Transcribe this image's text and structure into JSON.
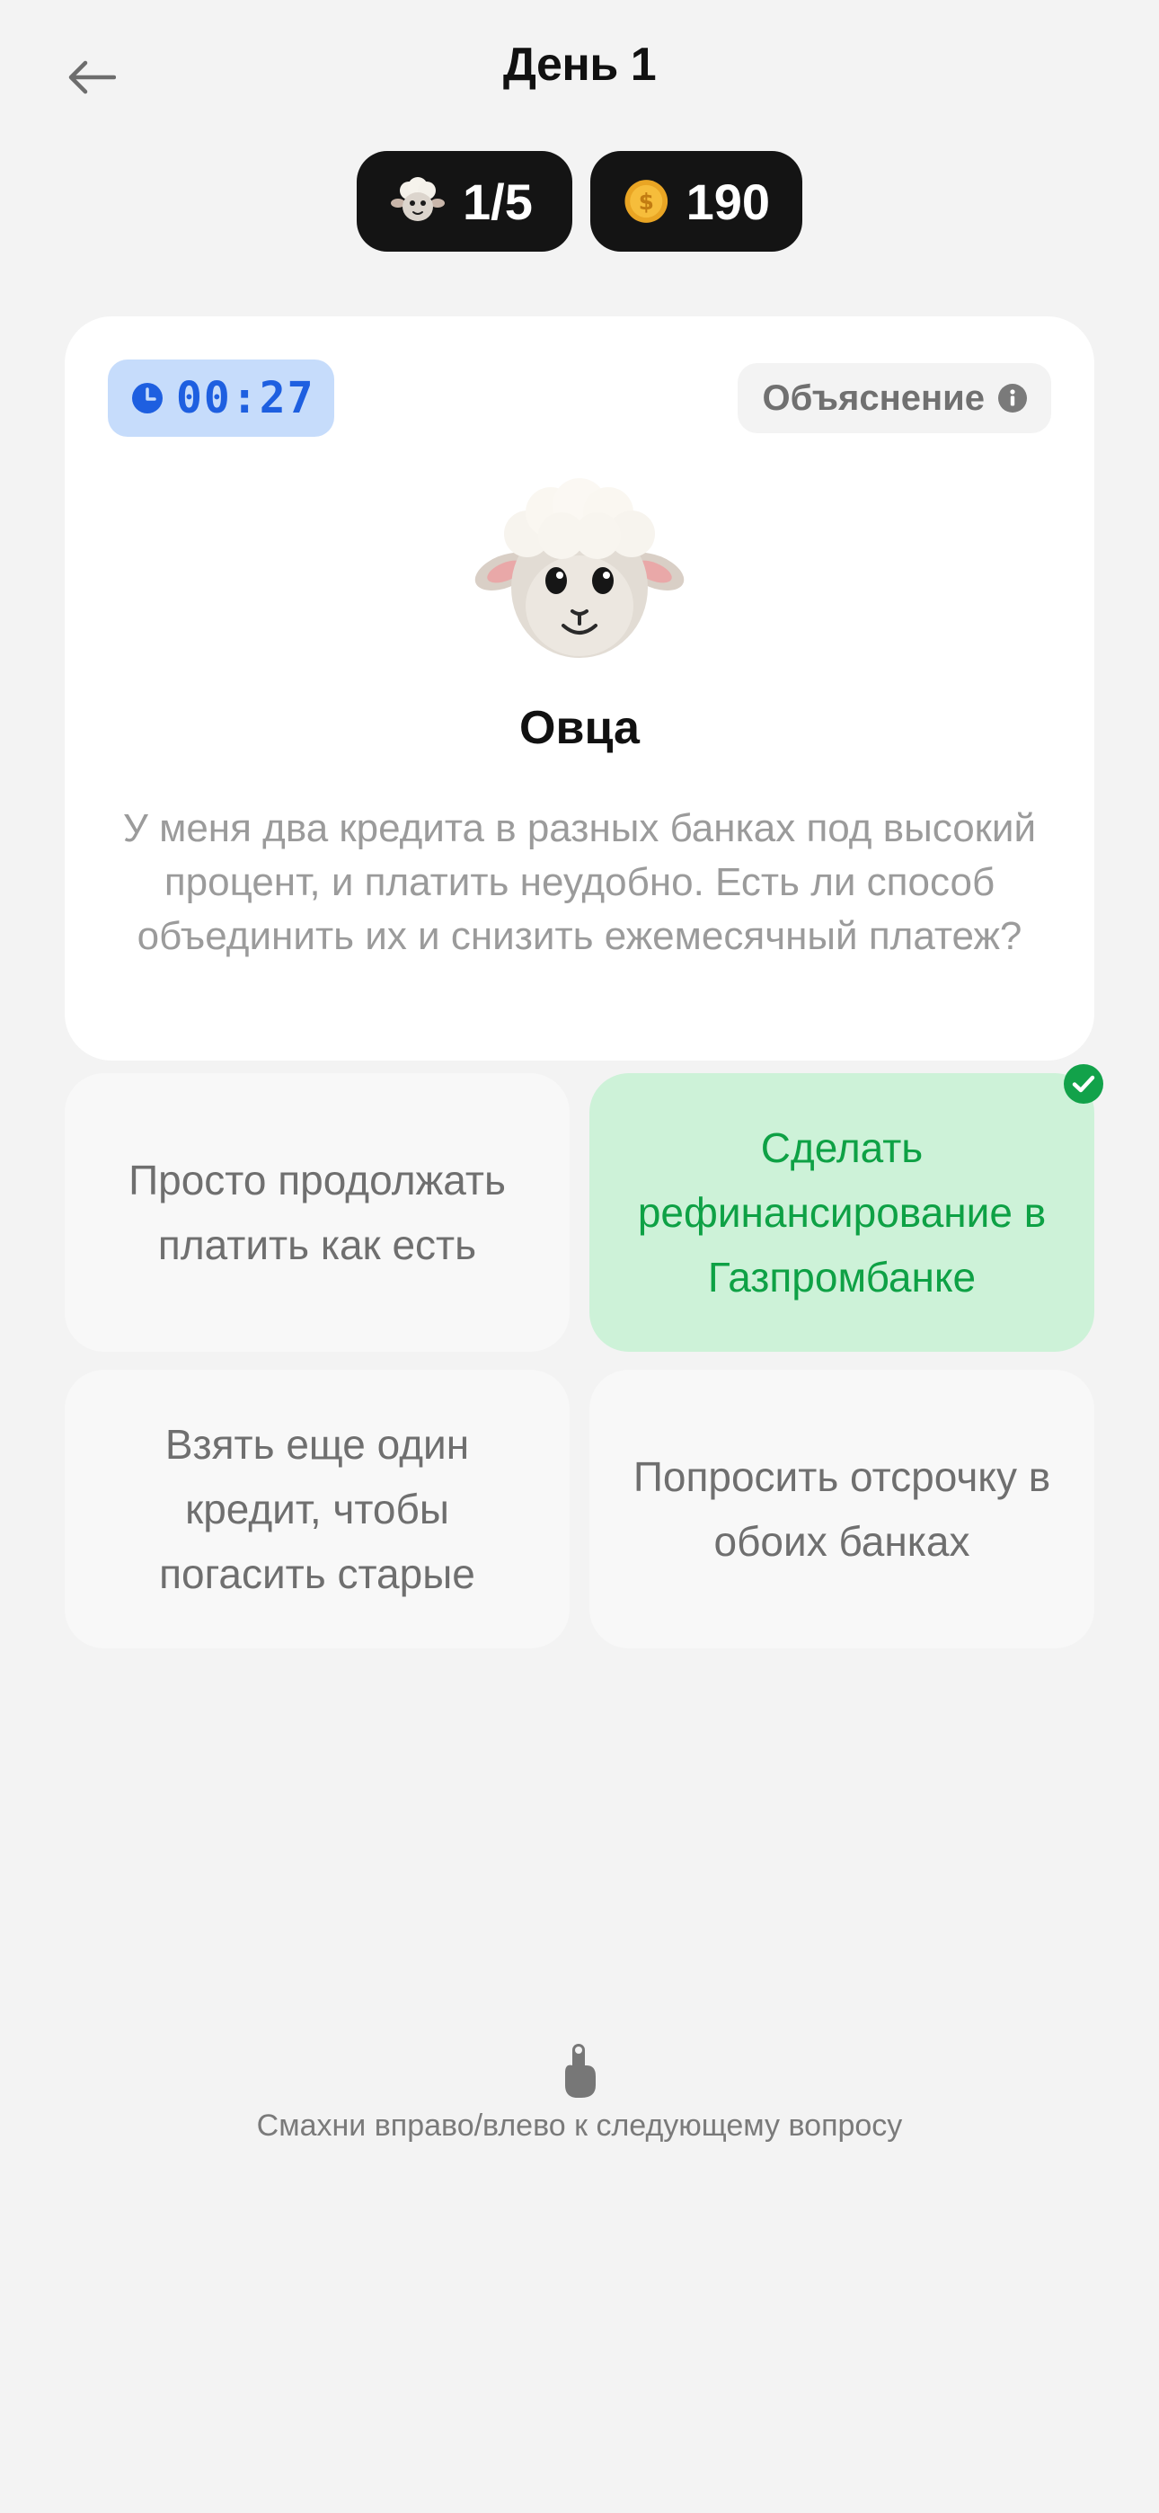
{
  "header": {
    "title": "День 1",
    "back_icon": "arrow-left-icon"
  },
  "stats": {
    "characters": {
      "icon": "sheep-face-icon",
      "value": "1/5"
    },
    "coins": {
      "icon": "coin-icon",
      "value": "190"
    }
  },
  "card": {
    "timer": {
      "icon": "clock-icon",
      "value": "00:27"
    },
    "explain": {
      "label": "Объяснение",
      "icon": "info-icon"
    },
    "character": {
      "icon": "sheep-avatar-icon",
      "name": "Овца"
    },
    "question": "У меня два кредита в разных банках под высокий процент, и платить неудобно. Есть ли способ объединить их и снизить ежемесячный платеж?"
  },
  "answers": [
    {
      "label": "Просто продолжать платить как есть",
      "correct": false
    },
    {
      "label": "Сделать рефинансирование в Газпромбанке",
      "correct": true,
      "badge_icon": "check-circle-icon"
    },
    {
      "label": "Взять еще один кредит, чтобы погасить старые",
      "correct": false
    },
    {
      "label": "Попросить отсрочку в обоих банках",
      "correct": false
    }
  ],
  "footer": {
    "icon": "swipe-hand-icon",
    "hint": "Смахни вправо/влево к следующему вопросу"
  },
  "colors": {
    "background": "#f3f3f3",
    "timer_bg": "#c6dcfb",
    "timer_text": "#1e5fe0",
    "correct_bg": "#cdf2d8",
    "correct_text": "#0ea145",
    "pill_bg": "#141414"
  }
}
